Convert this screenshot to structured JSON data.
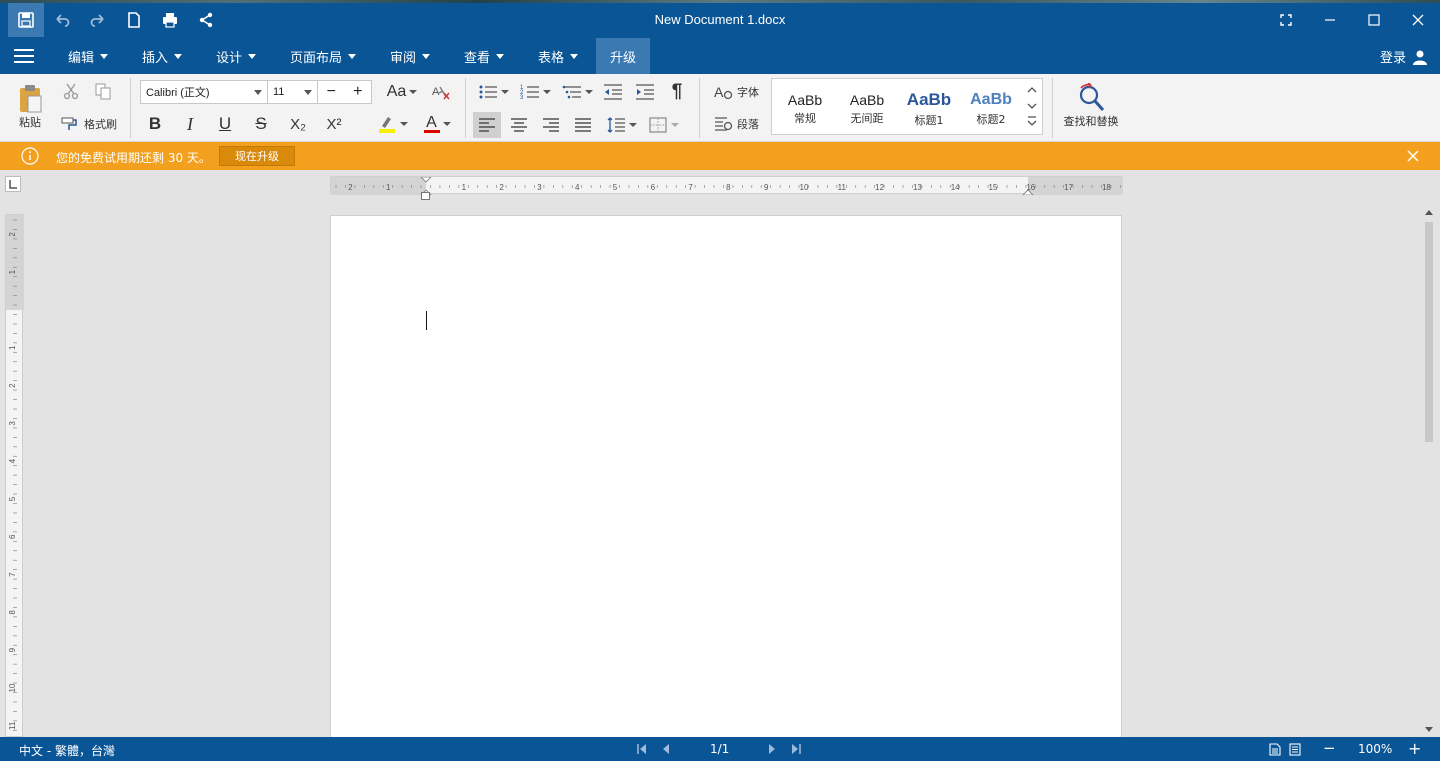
{
  "titlebar": {
    "document_title": "New Document 1.docx",
    "colors": {
      "bar": "#0a5596",
      "active": "#3b79b3"
    }
  },
  "menubar": {
    "items": [
      {
        "label": "编辑"
      },
      {
        "label": "插入"
      },
      {
        "label": "设计"
      },
      {
        "label": "页面布局"
      },
      {
        "label": "审阅"
      },
      {
        "label": "查看"
      },
      {
        "label": "表格"
      },
      {
        "label": "升级"
      }
    ],
    "login_label": "登录"
  },
  "ribbon": {
    "paste_label": "粘贴",
    "format_painter_label": "格式刷",
    "font_name": "Calibri (正文)",
    "font_size": "11",
    "size_decrease": "−",
    "size_increase": "+",
    "change_case": "Aa",
    "bold": "B",
    "italic": "I",
    "underline": "U",
    "strike": "S",
    "subscript": "X₂",
    "superscript": "X²",
    "text_color_glyph": "A",
    "font_panel_label": "字体",
    "paragraph_panel_label": "段落",
    "styles": [
      {
        "sample": "AaBb",
        "label": "常规"
      },
      {
        "sample": "AaBb",
        "label": "无间距"
      },
      {
        "sample": "AaBb",
        "label": "标题1"
      },
      {
        "sample": "AaBb",
        "label": "标题2"
      }
    ],
    "find_replace_label": "查找和替换"
  },
  "notice": {
    "message": "您的免费试用期还剩 30 天。",
    "upgrade_button": "现在升级",
    "color": "#f2a01e"
  },
  "ruler": {
    "horizontal_ticks": [
      "2",
      "1",
      "1",
      "2",
      "3",
      "4",
      "5",
      "6",
      "7",
      "8",
      "9",
      "10",
      "11",
      "12",
      "13",
      "14",
      "15",
      "16",
      "17",
      "18"
    ],
    "vertical_ticks": [
      "2",
      "1",
      "1",
      "2",
      "3",
      "4",
      "5",
      "6",
      "7",
      "8",
      "9",
      "10",
      "11"
    ]
  },
  "statusbar": {
    "language": "中文 - 繁體，台灣",
    "page_indicator": "1/1",
    "zoom_level": "100%",
    "zoom_out": "−",
    "zoom_in": "+"
  }
}
